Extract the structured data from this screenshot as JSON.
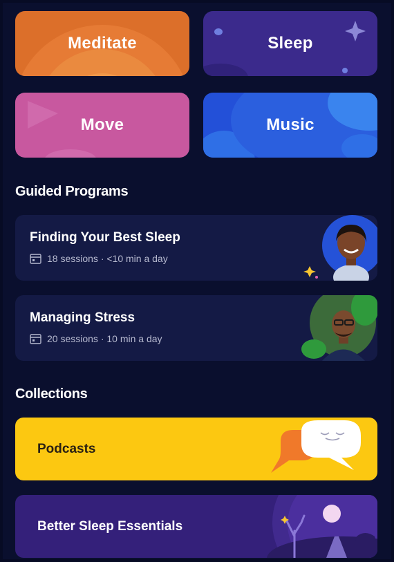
{
  "categories": {
    "meditate": "Meditate",
    "sleep": "Sleep",
    "move": "Move",
    "music": "Music"
  },
  "guided_programs": {
    "title": "Guided Programs",
    "items": [
      {
        "title": "Finding Your Best Sleep",
        "meta": "18 sessions · <10 min a day",
        "icon": "calendar-icon"
      },
      {
        "title": "Managing Stress",
        "meta": "20 sessions · 10 min a day",
        "icon": "calendar-icon"
      }
    ]
  },
  "collections": {
    "title": "Collections",
    "items": [
      {
        "title": "Podcasts",
        "color": "#fcc811"
      },
      {
        "title": "Better Sleep Essentials",
        "color": "#34207a"
      }
    ]
  },
  "colors": {
    "background": "#0a0f2e",
    "meditate": "#dc6f2a",
    "sleep": "#3b2a8c",
    "move": "#c8589f",
    "music": "#2350d8",
    "card": "#141a45"
  }
}
